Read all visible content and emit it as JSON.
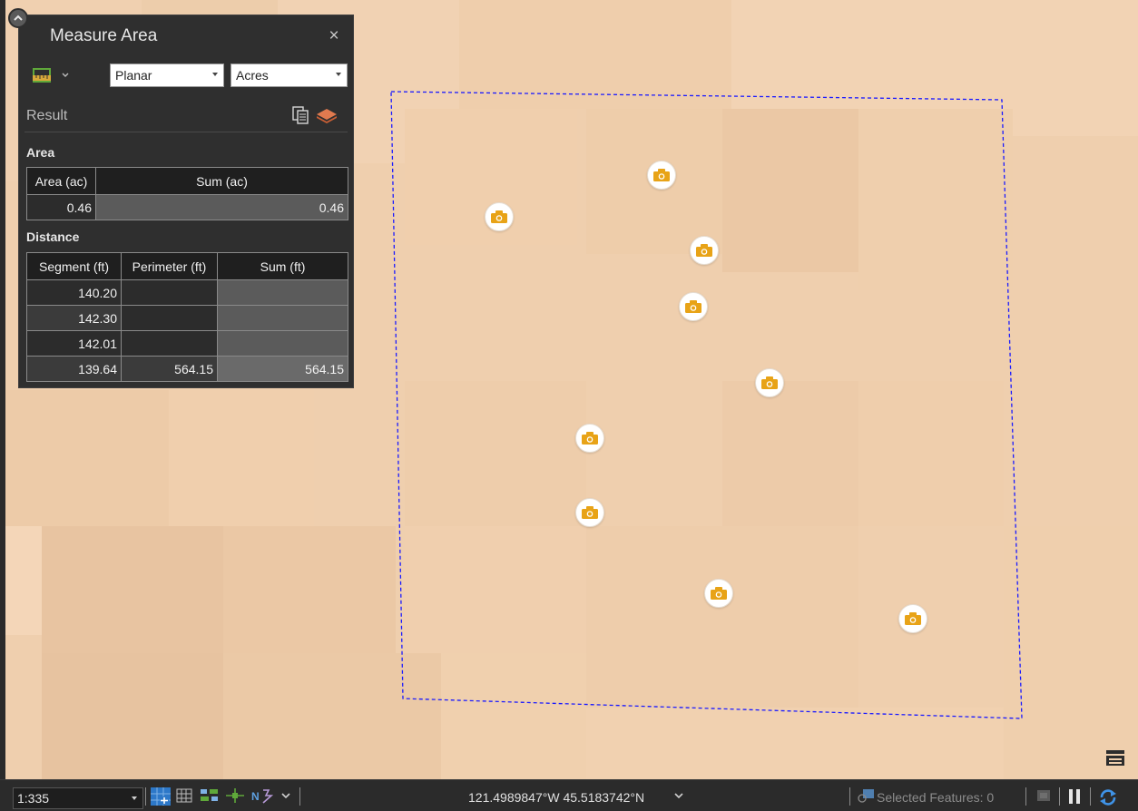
{
  "panel": {
    "title": "Measure Area",
    "close_label": "×",
    "mode": "Planar",
    "units": "Acres",
    "result_label": "Result",
    "area_section": "Area",
    "distance_section": "Distance"
  },
  "area_table": {
    "headers": [
      "Area (ac)",
      "Sum (ac)"
    ],
    "rows": [
      [
        "0.46",
        "0.46"
      ]
    ]
  },
  "distance_table": {
    "headers": [
      "Segment (ft)",
      "Perimeter (ft)",
      "Sum (ft)"
    ],
    "rows": [
      [
        "140.20",
        "",
        ""
      ],
      [
        "142.30",
        "",
        ""
      ],
      [
        "142.01",
        "",
        ""
      ],
      [
        "139.64",
        "564.15",
        "564.15"
      ]
    ]
  },
  "status_bar": {
    "scale": "1:335",
    "coordinates": "121.4989847°W 45.5183742°N",
    "selected_features": "Selected Features: 0"
  },
  "map": {
    "measure_outline_color": "#1a1aff",
    "photo_marker_count": 9,
    "photo_marker_color": "#e8a317"
  },
  "icons": {
    "collapse": "chevron-up-icon",
    "measure_tool": "measure-ruler-icon",
    "copy": "copy-icon",
    "layer": "layer-icon",
    "marker": "camera-icon",
    "map_corner": "filmstrip-icon"
  }
}
